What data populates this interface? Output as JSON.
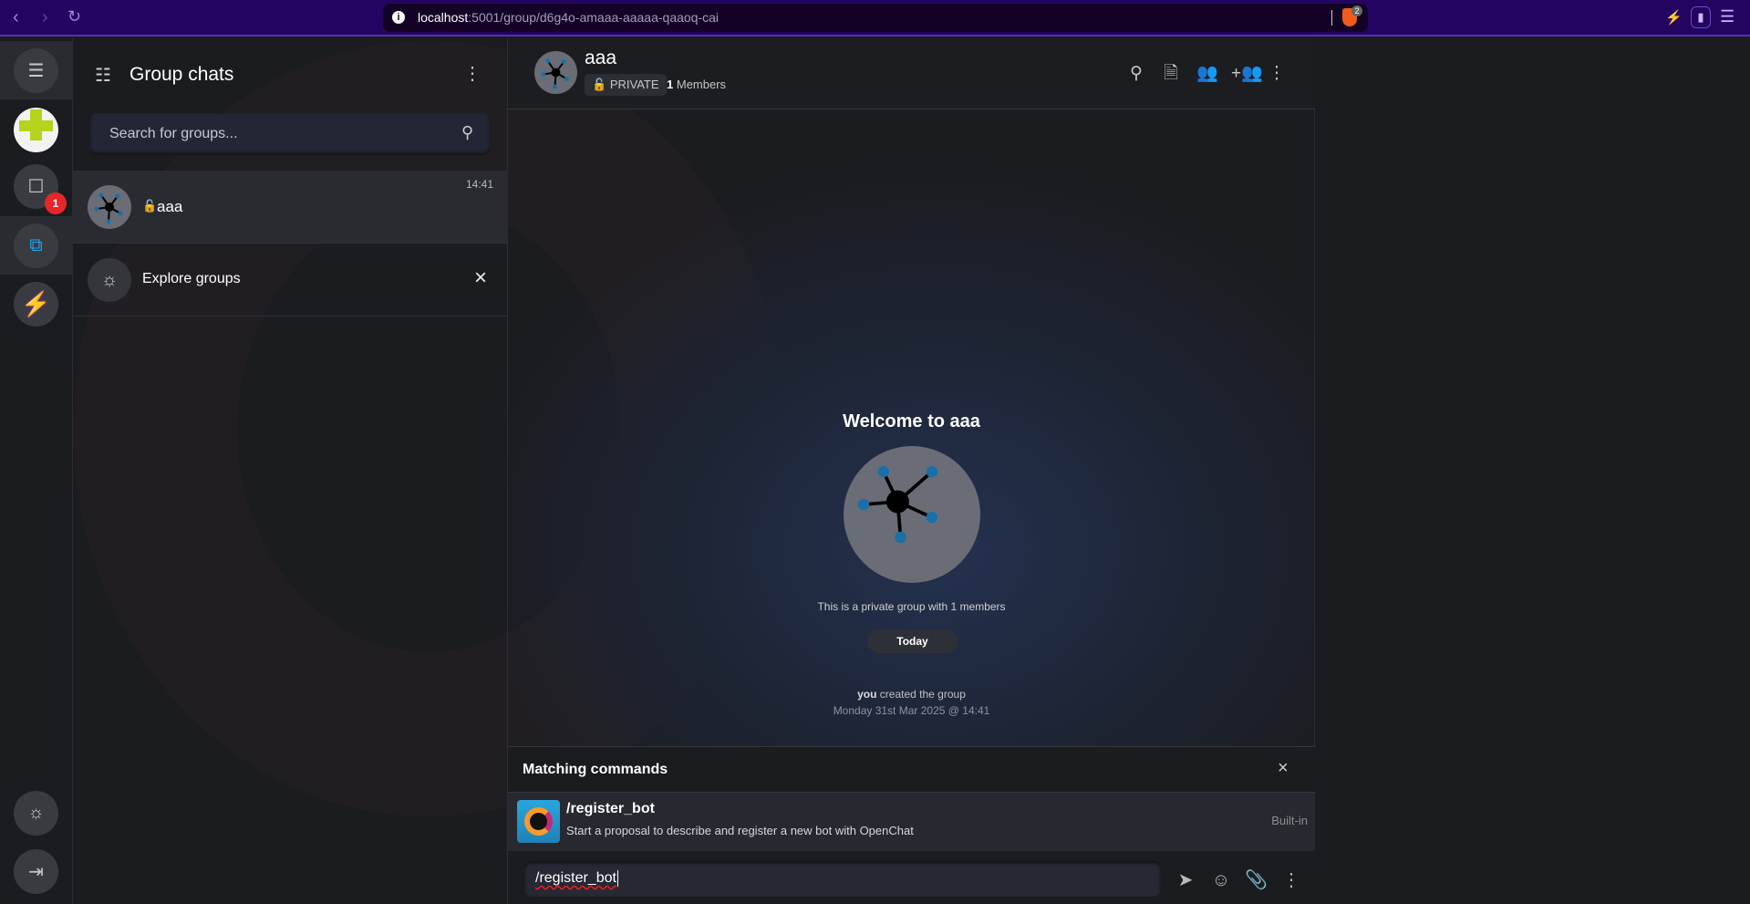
{
  "browser": {
    "url_host": "localhost",
    "url_path": ":5001/group/d6g4o-amaaa-aaaaa-qaaoq-cai",
    "shield_count": "2"
  },
  "rail": {
    "unread_badge": "1"
  },
  "list": {
    "title": "Group chats",
    "search_placeholder": "Search for groups...",
    "groups": [
      {
        "name": "aaa",
        "time": "14:41"
      }
    ],
    "explore_label": "Explore groups"
  },
  "chat": {
    "name": "aaa",
    "privacy": "PRIVATE",
    "member_count": "1",
    "members_label": "Members",
    "welcome": "Welcome to aaa",
    "private_note": "This is a private group with 1 members",
    "date_pill": "Today",
    "event_actor": "you",
    "event_text": "created the group",
    "event_time": "Monday 31st Mar 2025 @ 14:41"
  },
  "commands": {
    "title": "Matching commands",
    "items": [
      {
        "name": "/register_bot",
        "description": "Start a proposal to describe and register a new bot with OpenChat",
        "tag": "Built-in"
      }
    ]
  },
  "composer": {
    "value": "/register_bot"
  },
  "colors": {
    "accent": "#1fa8f1",
    "lock": "#e8262a",
    "browser": "#230460"
  }
}
